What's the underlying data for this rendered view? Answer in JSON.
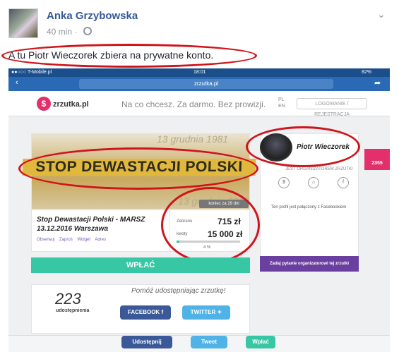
{
  "post": {
    "author": "Anka Grzybowska",
    "time": "40 min",
    "separator": "·",
    "text": "A tu Piotr Wieczorek zbiera na prywatne konto."
  },
  "icons": {
    "menu": "chevron-down-icon",
    "privacy": "globe-icon"
  },
  "phone": {
    "carrier": "●●○○○ T-Mobile.pl",
    "clock": "18:01",
    "battery": "82%",
    "url": "zrzutka.pl"
  },
  "site": {
    "logo_letter": "$",
    "brand": "zrzutka.pl",
    "tagline": "Na co chcesz. Za darmo. Bez prowizji.",
    "lang": [
      "PL",
      "EN"
    ],
    "login": "LOGOWANIE / REJESTRACJA",
    "date_top": "13 grudnia 1981",
    "date_bottom": "13 grudnia 2016",
    "banner": "STOP DEWASTACJI POLSKI",
    "event_title": "Stop Dewastacji Polski - MARSZ 13.12.2016 Warszawa",
    "actions": [
      "Obserwuj",
      "Zaproś",
      "Widget",
      "Adres"
    ],
    "ends_badge": "koniec za 29 dni",
    "raised_label": "Zebrano",
    "raised": "715 zł",
    "goal_label": "kwoty",
    "goal": "15 000 zł",
    "percent_text": "4 %",
    "progress": 0.048,
    "pay": "WPŁAĆ",
    "organizer": "Piotr Wieczorek",
    "organizer_role": "JEST ORGANIZATOREM ZRZUTKI",
    "fb_note": "Ten profil jest połączony z Facebookiem",
    "ask": "Zadaj pytanie organizatorowi tej zrzutki",
    "side_count": "2355",
    "shares": "223",
    "shares_label": "udostępnienia",
    "share_prompt": "Pomóż udostępniając zrzutkę!",
    "facebook": "FACEBOOK",
    "twitter": "TWITTER",
    "bottom": [
      "Udostępnij",
      "Tweet",
      "Wpłać"
    ]
  },
  "colors": {
    "annotation_red": "#d0141b",
    "brand_pink": "#e3306c",
    "pay_green": "#37c7a5",
    "link_blue": "#365899"
  }
}
